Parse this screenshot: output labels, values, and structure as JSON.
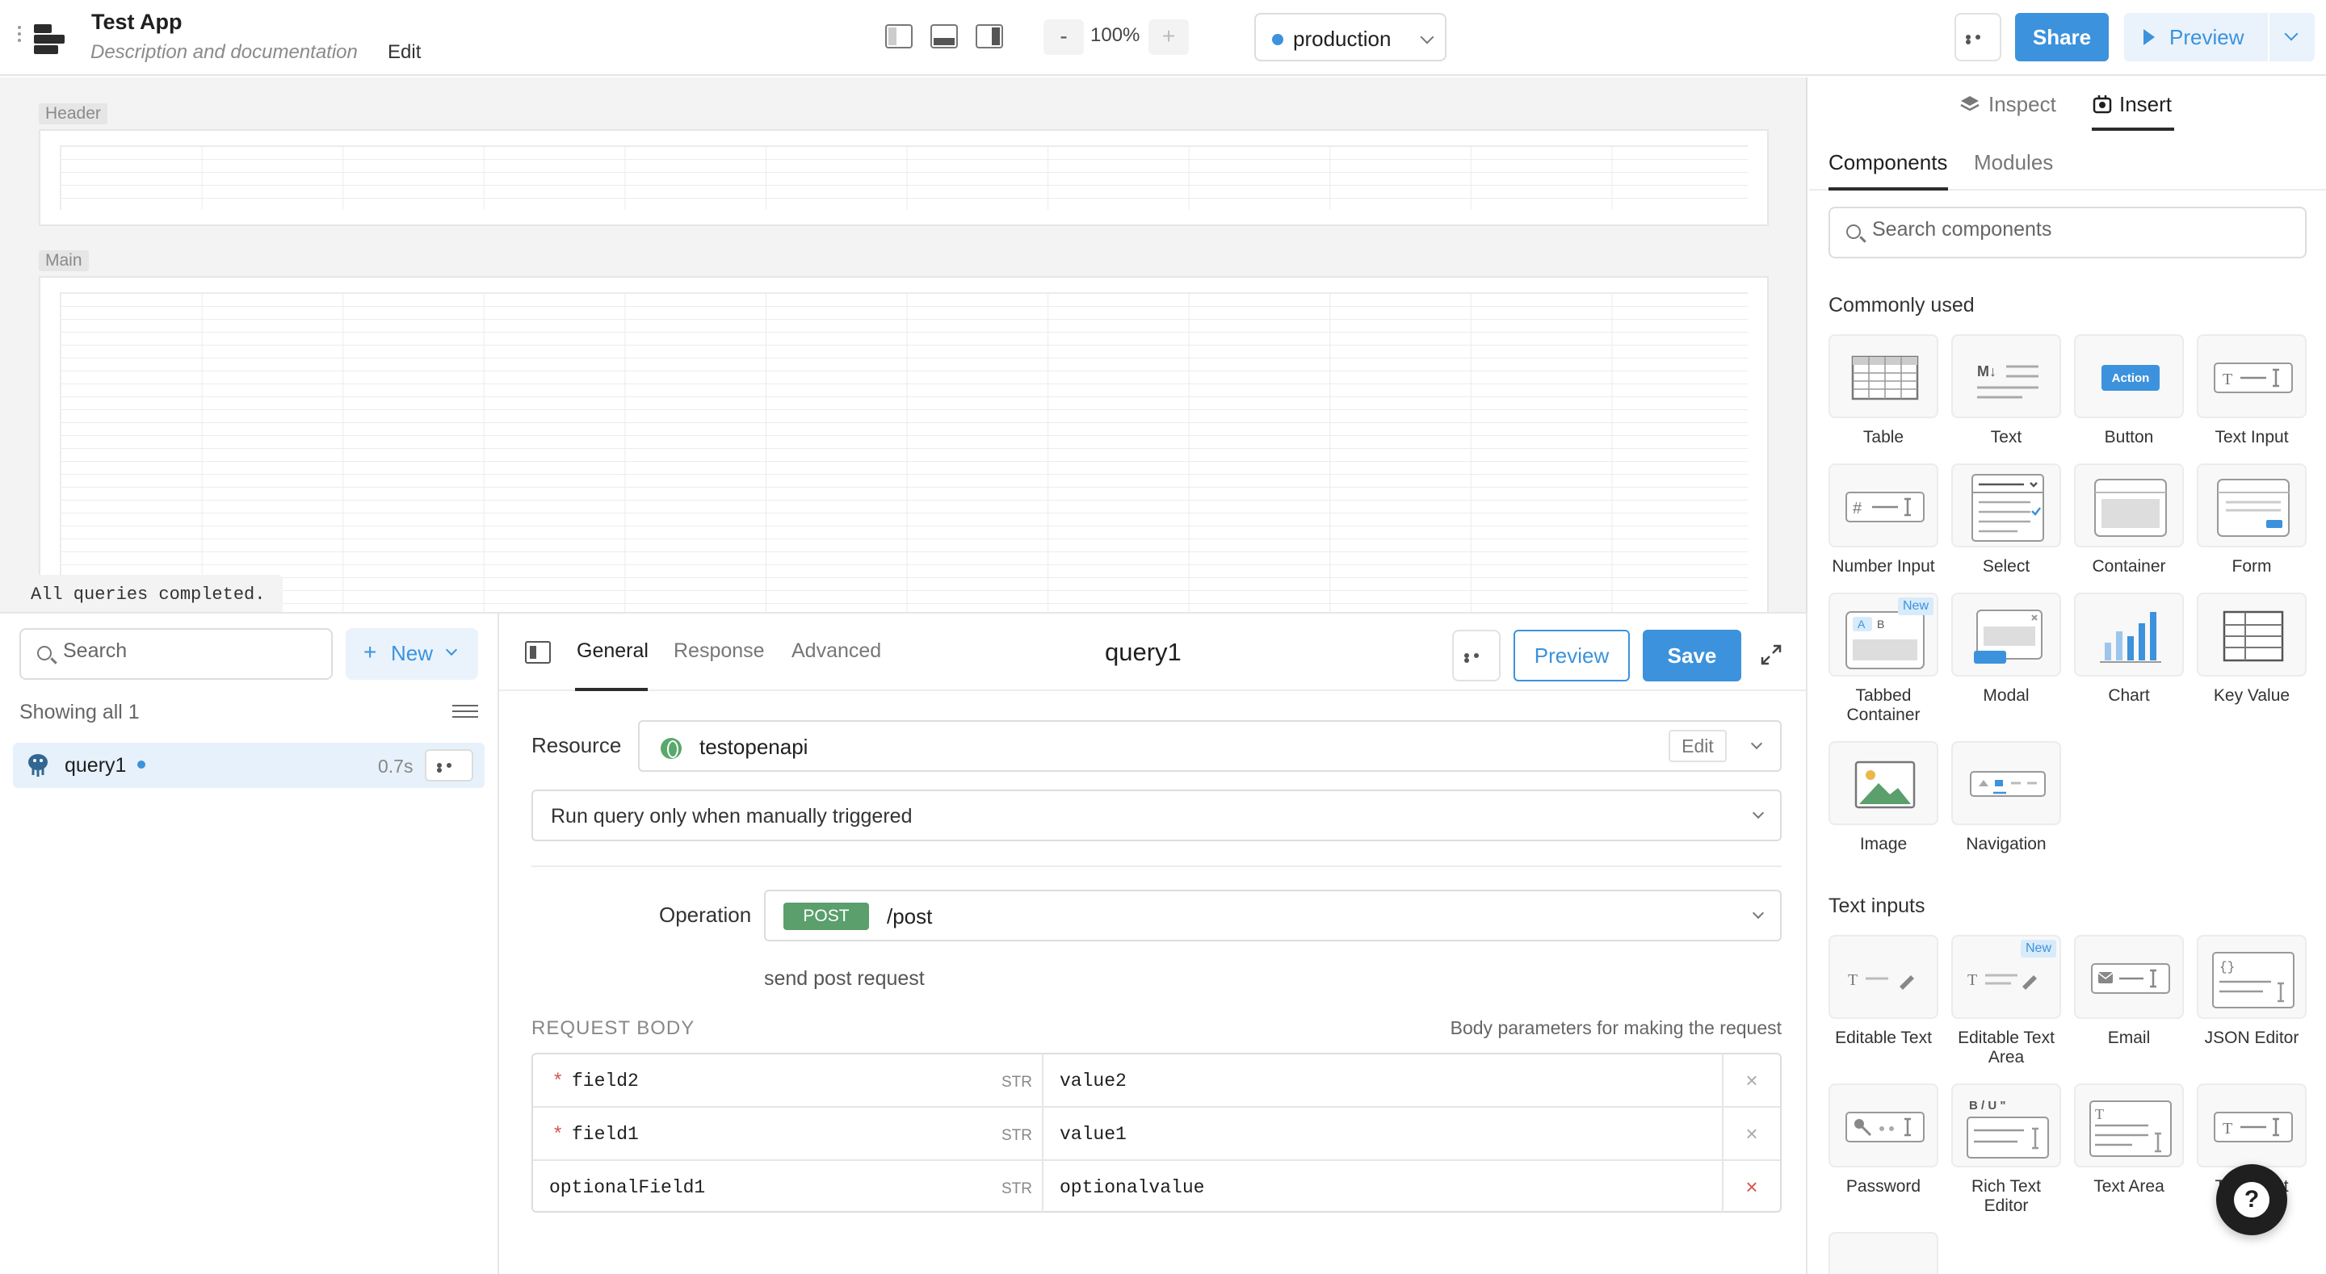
{
  "header": {
    "app_name": "Test App",
    "app_description": "Description and documentation",
    "edit_label": "Edit",
    "zoom_minus": "-",
    "zoom_level": "100%",
    "zoom_plus": "+",
    "environment": "production",
    "share_label": "Share",
    "preview_label": "Preview"
  },
  "canvas": {
    "header_label": "Header",
    "main_label": "Main",
    "status": "All queries completed."
  },
  "query_list": {
    "search_placeholder": "Search",
    "new_label": "New",
    "showing_text": "Showing all 1",
    "queries": [
      {
        "name": "query1",
        "time": "0.7s"
      }
    ]
  },
  "editor": {
    "tabs": [
      "General",
      "Response",
      "Advanced"
    ],
    "title": "query1",
    "preview_label": "Preview",
    "save_label": "Save",
    "resource_label": "Resource",
    "resource_name": "testopenapi",
    "resource_edit": "Edit",
    "trigger": "Run query only when manually triggered",
    "operation_label": "Operation",
    "method": "POST",
    "path": "/post",
    "operation_desc": "send post request",
    "request_body_title": "REQUEST BODY",
    "request_body_hint": "Body parameters for making the request",
    "params": [
      {
        "required": "*",
        "name": "field2",
        "type": "STR",
        "value": "value2"
      },
      {
        "required": "*",
        "name": "field1",
        "type": "STR",
        "value": "value1"
      },
      {
        "required": "",
        "name": "optionalField1",
        "type": "STR",
        "value": "optionalvalue"
      }
    ],
    "delete_glyph": "×"
  },
  "right_panel": {
    "inspect_label": "Inspect",
    "insert_label": "Insert",
    "components_tab": "Components",
    "modules_tab": "Modules",
    "search_placeholder": "Search components",
    "commonly_used_title": "Commonly used",
    "commonly_used": [
      {
        "label": "Table",
        "icon": "table-icon"
      },
      {
        "label": "Text",
        "icon": "text-markdown-icon"
      },
      {
        "label": "Button",
        "icon": "button-icon",
        "icon_text": "Action"
      },
      {
        "label": "Text Input",
        "icon": "text-input-icon"
      },
      {
        "label": "Number Input",
        "icon": "number-input-icon"
      },
      {
        "label": "Select",
        "icon": "select-icon"
      },
      {
        "label": "Container",
        "icon": "container-icon"
      },
      {
        "label": "Form",
        "icon": "form-icon"
      },
      {
        "label": "Tabbed Container",
        "icon": "tabbed-container-icon",
        "badge": "New"
      },
      {
        "label": "Modal",
        "icon": "modal-icon"
      },
      {
        "label": "Chart",
        "icon": "chart-icon"
      },
      {
        "label": "Key Value",
        "icon": "key-value-icon"
      },
      {
        "label": "Image",
        "icon": "image-icon"
      },
      {
        "label": "Navigation",
        "icon": "navigation-icon"
      }
    ],
    "text_inputs_title": "Text inputs",
    "text_inputs": [
      {
        "label": "Editable Text",
        "icon": "editable-text-icon"
      },
      {
        "label": "Editable Text Area",
        "icon": "editable-text-area-icon",
        "badge": "New"
      },
      {
        "label": "Email",
        "icon": "email-icon"
      },
      {
        "label": "JSON Editor",
        "icon": "json-editor-icon"
      },
      {
        "label": "Password",
        "icon": "password-icon"
      },
      {
        "label": "Rich Text Editor",
        "icon": "rich-text-editor-icon"
      },
      {
        "label": "Text Area",
        "icon": "text-area-icon"
      },
      {
        "label": "Text Input",
        "icon": "text-input-icon"
      }
    ],
    "help_glyph": "?"
  },
  "colors": {
    "accent": "#3c92dc",
    "post_badge": "#5a9f6c",
    "required": "#d9534f"
  }
}
